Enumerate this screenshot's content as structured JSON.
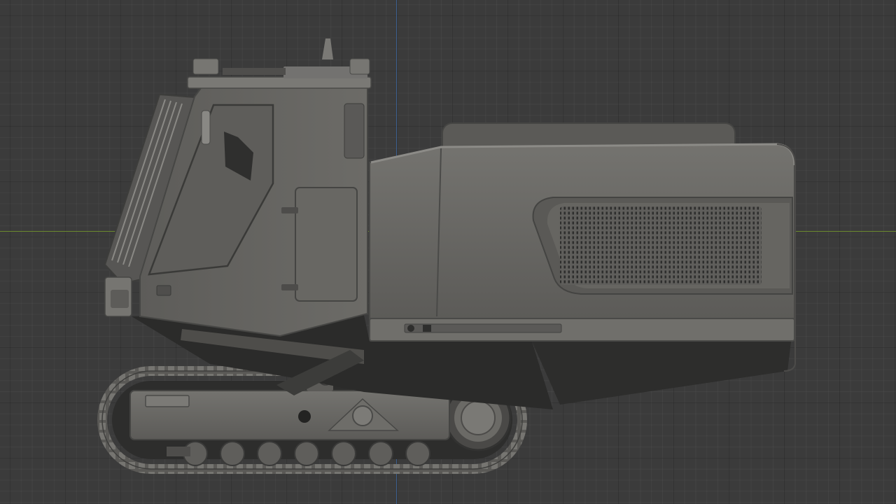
{
  "viewport": {
    "mode": "orthographic-side-view",
    "grid": true,
    "colors": {
      "background": "#3b3b3b",
      "axis_x": "#6b8a2e",
      "axis_z": "#3d5f8f",
      "model_body": "#6a6a66",
      "model_dark": "#2b2b2b"
    }
  },
  "model": {
    "subject": "tracked-vehicle-with-cab",
    "parts": [
      "cab",
      "engine-housing",
      "vent-grille",
      "undercarriage",
      "track",
      "drive-sprocket",
      "road-wheels"
    ]
  }
}
